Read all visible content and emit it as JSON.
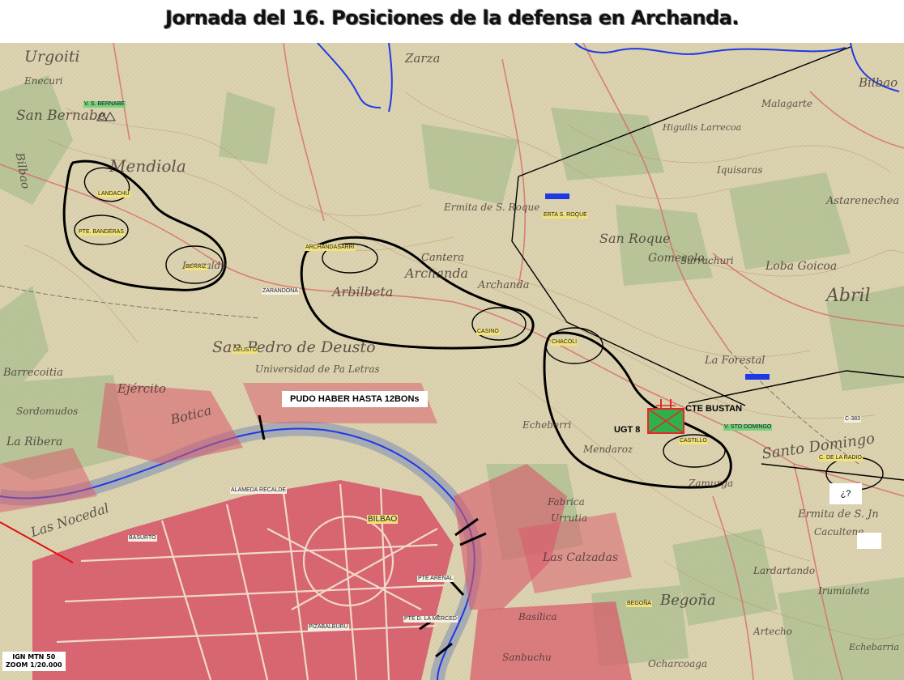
{
  "title": "Jornada del 16. Posiciones de la defensa en Archanda.",
  "map_labels": {
    "v_s_bernabe": "V. S. BERNABE",
    "landachu": "LANDACHU",
    "pte_banderas": "PTE. BANDERAS",
    "berriz": "BERRIZ",
    "archandasarri": "ARCHANDASARRI",
    "zarandona": "ZARANDONA",
    "casino": "CASINO",
    "deusto": "DEUSTO",
    "erita_s_roque": "ERTA S. ROQUE",
    "chacoli": "CHACOLI",
    "v_sto_domingo": "V. STO DOMINGO",
    "c383": "C-383",
    "castillo": "CASTILLO",
    "c_de_la_radio": "C. DE LA RADIO",
    "alameda_recalde": "ALAMEDA RECALDE",
    "bilbao": "BILBAO",
    "basurto": "BASURTO",
    "pte_arenal": "PTE ARENAL",
    "pte_merced": "PTE D. LA MERCED",
    "pizabalburu": "PIZABALBURU",
    "begona": "BEGOÑA"
  },
  "callout_battalions": "PUDO HABER HASTA 12BONs",
  "unit_cte_bustan": "CTE BUSTAN",
  "unit_ugt8": "UGT 8",
  "question_mark": "¿?",
  "scale_lines": [
    "IGN MTN 50",
    "ZOOM 1/20.000"
  ],
  "base_map_names": {
    "urgoiti": "Urgoiti",
    "enecuri": "Enecuri",
    "san_bernabe": "San Bernabe",
    "mendiola": "Mendiola",
    "bilbao_road": "Bilbao",
    "archanda": "Archanda",
    "san_roque": "San Roque",
    "gomesolo": "Gomesolo",
    "loba_goicoa": "Loba Goicoa",
    "astarenechea": "Astarenechea",
    "abril": "Abril",
    "la_forestal": "La Forestal",
    "san_pedro_deusto": "San Pedro de Deusto",
    "universidad": "Universidad de Pa Letras",
    "ejercito": "Ejército",
    "botica": "Botica",
    "la_ribera": "La Ribera",
    "sordomudos": "Sordomudos",
    "barrecoitia": "Barrecoitia",
    "las_nocedal": "Las Nocedal",
    "santo_domingo": "Santo Domingo",
    "ermita_sjn": "Ermita de S. Jn",
    "cacultene": "Cacultene",
    "lardartando": "Lardartando",
    "las_calzadas": "Las Calzadas",
    "begona_map": "Begoña",
    "basilica": "Basílica",
    "ocharcoaga": "Ocharcoaga",
    "zarza": "Zarza",
    "bilbao_ne": "Bilbao",
    "malagarte": "Malagarte",
    "iquisaras": "Iquisaras",
    "higuilis": "Higuilis Larrecoa",
    "sarrachuri": "Sarrachuri",
    "ermita_roque": "Ermita de S. Roque",
    "echeandia": "Echeberri",
    "lauraldu": "Lauraldu",
    "artecho": "Artecho",
    "irumialeta": "Irumialeta",
    "echebarria": "Echebarria",
    "mendaroz": "Mendaroz",
    "zamurga": "Zamurga",
    "fabrica": "Fabrica",
    "urrutia": "Urrutia",
    "san_chu": "Sanbuchu",
    "cantera": "Cantera",
    "argaz": "Archanda",
    "arrigoriaga": "Arbilbeta"
  },
  "colors": {
    "river": "#1f38e6",
    "city_blocks": "#d9576a",
    "defense_line": "#000000",
    "label_highlight": "#f2e27a",
    "label_green": "#7bd17b",
    "unit_fill": "#2fb04a",
    "unit_border": "#e02a2a"
  }
}
